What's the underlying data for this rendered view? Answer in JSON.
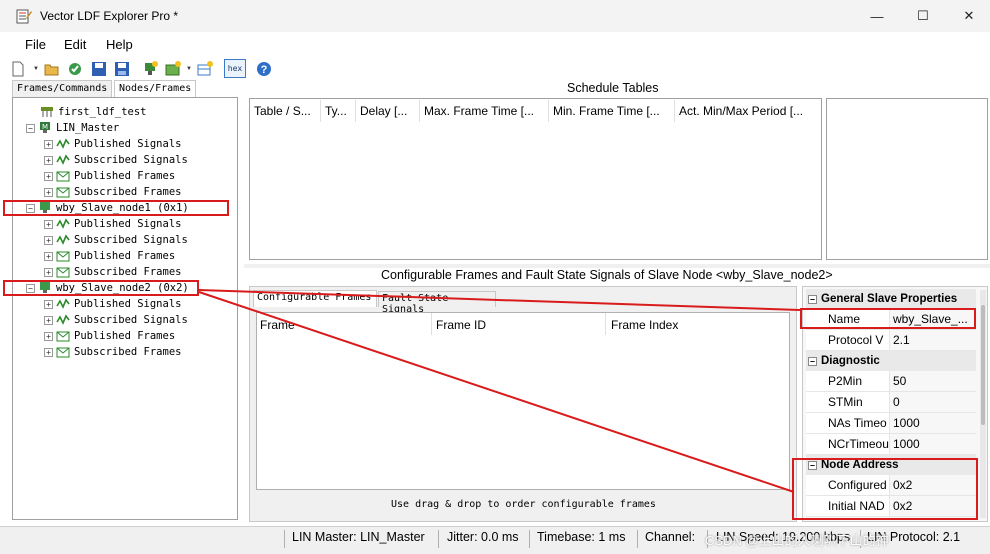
{
  "window": {
    "title": "Vector LDF Explorer Pro *",
    "controls": [
      "—",
      "☐",
      "✕"
    ]
  },
  "menu": [
    "File",
    "Edit",
    "Help"
  ],
  "toolbar": {
    "hex_label": "hex"
  },
  "left_tabs": [
    "Frames/Commands",
    "Nodes/Frames"
  ],
  "tree": {
    "root": "first_ldf_test",
    "nodes": [
      {
        "label": "LIN_Master",
        "children": [
          "Published Signals",
          "Subscribed Signals",
          "Published Frames",
          "Subscribed Frames"
        ]
      },
      {
        "label": "wby_Slave_node1 (0x1)",
        "children": [
          "Published Signals",
          "Subscribed Signals",
          "Published Frames",
          "Subscribed Frames"
        ]
      },
      {
        "label": "wby_Slave_node2 (0x2)",
        "children": [
          "Published Signals",
          "Subscribed Signals",
          "Published Frames",
          "Subscribed Frames"
        ]
      }
    ]
  },
  "schedule": {
    "title": "Schedule Tables",
    "columns": [
      "Table / S...",
      "Ty...",
      "Delay [...",
      "Max. Frame Time [...",
      "Min. Frame Time [...",
      "Act. Min/Max Period [..."
    ]
  },
  "config": {
    "title": "Configurable Frames and Fault State Signals of Slave Node <wby_Slave_node2>",
    "tabs": [
      "Configurable Frames",
      "Fault State Signals"
    ],
    "columns": [
      "Frame",
      "Frame ID",
      "Frame Index"
    ],
    "hint": "Use drag & drop to order configurable frames"
  },
  "properties": {
    "categories": [
      {
        "name": "General Slave Properties",
        "rows": [
          {
            "name": "Name",
            "value": "wby_Slave_..."
          },
          {
            "name": "Protocol V",
            "value": "2.1"
          }
        ]
      },
      {
        "name": "Diagnostic",
        "rows": [
          {
            "name": "P2Min",
            "value": "50"
          },
          {
            "name": "STMin",
            "value": "0"
          },
          {
            "name": "NAs Timeo",
            "value": "1000"
          },
          {
            "name": "NCrTimeou",
            "value": "1000"
          }
        ]
      },
      {
        "name": "Node Address",
        "rows": [
          {
            "name": "Configured",
            "value": "0x2"
          },
          {
            "name": "Initial NAD",
            "value": "0x2"
          }
        ]
      }
    ]
  },
  "status": {
    "master": "LIN Master: LIN_Master",
    "jitter": "Jitter: 0.0 ms",
    "timebase": "Timebase: 1 ms",
    "channel": "Channel:",
    "speed": "LIN Speed: 19.200 kbps",
    "protocol": "LIN Protocol: 2.1"
  },
  "watermark": "CSDN @上山的人喇叭下山的神",
  "colors": {
    "annotation_red": "#d91b1b",
    "accent_blue": "#3b79c9"
  }
}
